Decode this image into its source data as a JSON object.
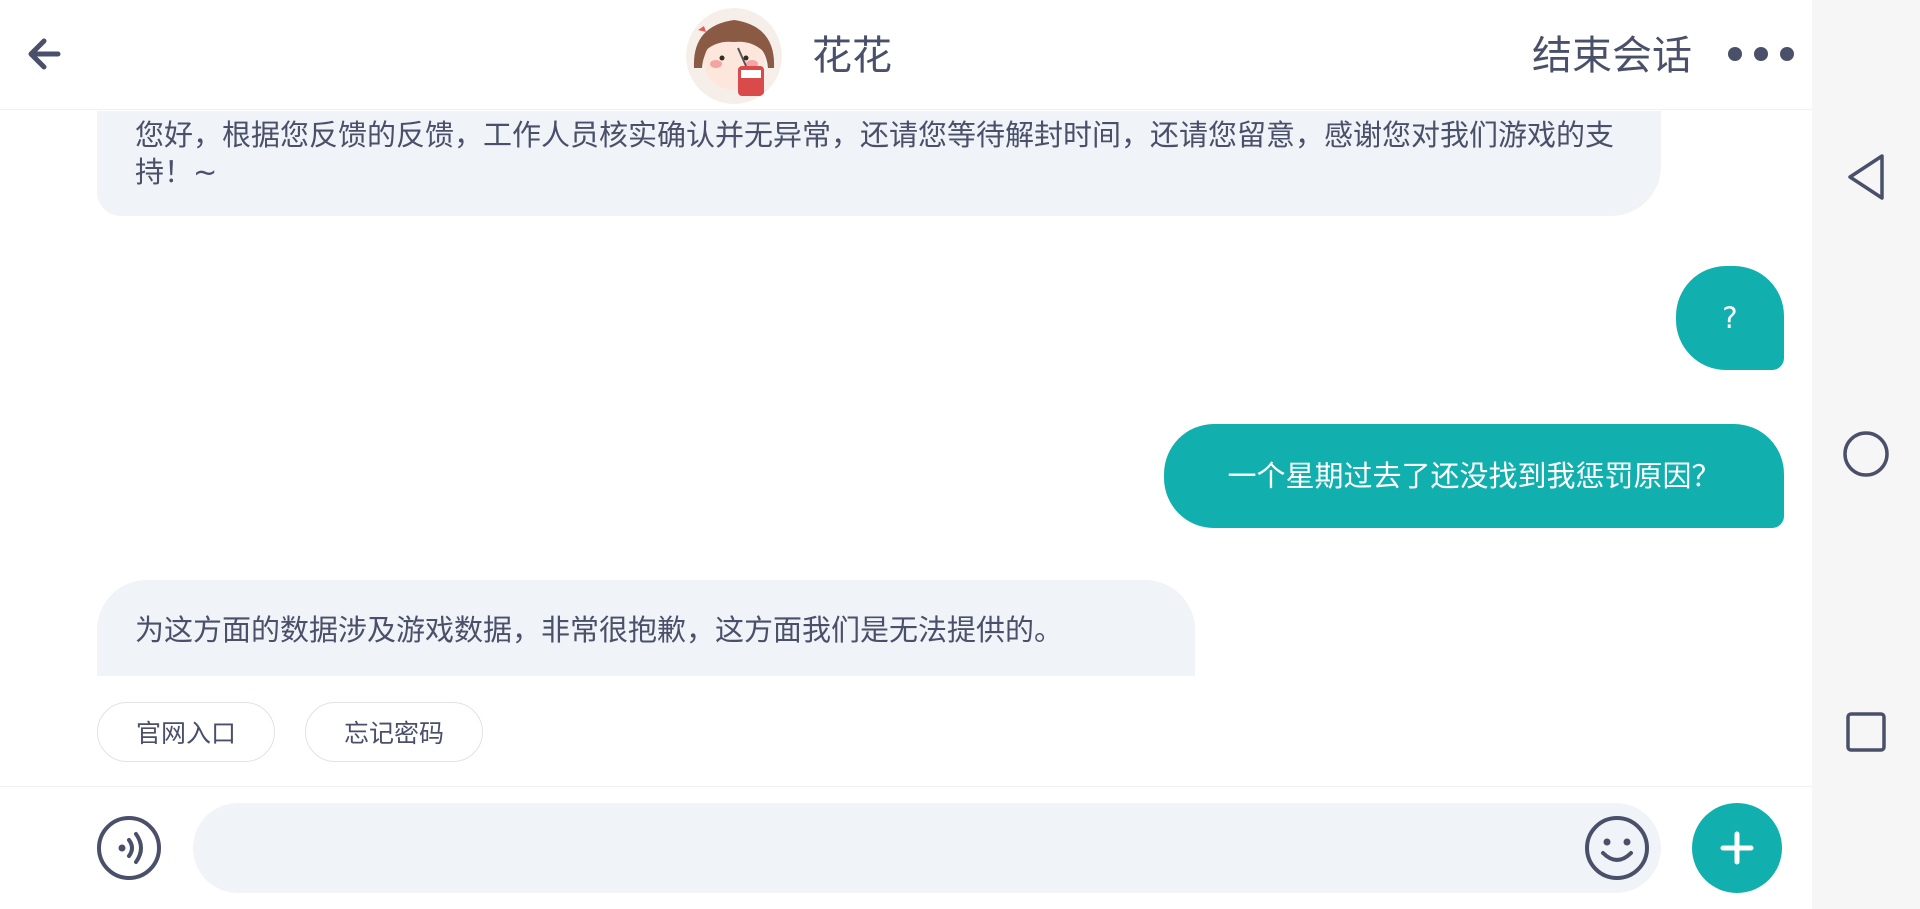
{
  "header": {
    "title": "花花",
    "end_session_label": "结束会话",
    "back_icon": "arrow-left-icon",
    "more_icon": "more-dots-icon",
    "avatar": "avatar"
  },
  "messages": [
    {
      "sender": "agent",
      "text": "您好，根据您反馈的反馈，工作人员核实确认并无异常，还请您等待解封时间，还请您留意，感谢您对我们游戏的支持！~"
    },
    {
      "sender": "user",
      "text": "?"
    },
    {
      "sender": "user",
      "text": "一个星期过去了还没找到我惩罚原因？"
    },
    {
      "sender": "agent",
      "text": "为这方面的数据涉及游戏数据，非常很抱歉，这方面我们是无法提供的。"
    }
  ],
  "quick_replies": [
    {
      "label": "官网入口"
    },
    {
      "label": "忘记密码"
    }
  ],
  "input_bar": {
    "placeholder": "",
    "voice_icon": "voice-icon",
    "emoji_icon": "emoji-icon",
    "plus_icon": "plus-icon"
  },
  "system_nav": {
    "back_icon": "nav-back-triangle-icon",
    "home_icon": "nav-home-circle-icon",
    "recent_icon": "nav-recent-square-icon"
  },
  "colors": {
    "accent": "#12afaf",
    "incoming_bubble": "#f0f3f7",
    "text": "#4a5069"
  }
}
